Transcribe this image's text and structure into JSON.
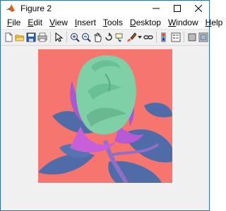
{
  "window": {
    "title": "Figure 2"
  },
  "menu": {
    "file": {
      "label": "File",
      "mnemonic": "F",
      "rest": "ile"
    },
    "edit": {
      "label": "Edit",
      "mnemonic": "E",
      "rest": "dit"
    },
    "view": {
      "label": "View",
      "mnemonic": "V",
      "rest": "iew"
    },
    "insert": {
      "label": "Insert",
      "mnemonic": "I",
      "rest": "nsert"
    },
    "tools": {
      "label": "Tools",
      "mnemonic": "T",
      "rest": "ools"
    },
    "desktop": {
      "label": "Desktop",
      "mnemonic": "D",
      "rest": "esktop"
    },
    "window": {
      "label": "Window",
      "mnemonic": "W",
      "rest": "indow"
    },
    "help": {
      "label": "Help",
      "mnemonic": "H",
      "rest": "elp"
    }
  },
  "toolbar": {
    "icons": [
      "new-figure-icon",
      "open-file-icon",
      "save-figure-icon",
      "print-figure-icon",
      "edit-plot-icon",
      "zoom-in-icon",
      "zoom-out-icon",
      "pan-icon",
      "rotate-3d-icon",
      "data-cursor-icon",
      "brush-icon",
      "link-plot-icon",
      "insert-colorbar-icon",
      "insert-legend-icon",
      "hide-plot-tools-icon",
      "show-plot-tools-icon"
    ]
  },
  "colors": {
    "image_background": "#f6766f",
    "rose_petal": "#7fd0a6",
    "sepal": "#c760d8",
    "leaf": "#4f6ca8",
    "title_bar": "#ffffff",
    "figure_background": "#f0f0f0"
  }
}
